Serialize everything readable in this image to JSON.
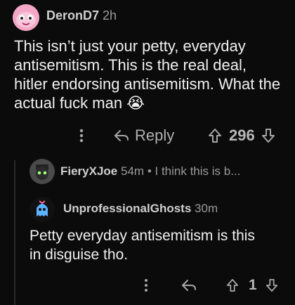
{
  "post": {
    "username": "DeronD7",
    "time": "2h",
    "body": "This isn’t just your petty, everyday antisemitism. This is the real deal, hitler endorsing antisemitism. What the actual fuck man",
    "emoji": "😭",
    "reply_label": "Reply",
    "score": "296"
  },
  "replies": [
    {
      "username": "FieryXJoe",
      "time": "54m",
      "separator": "•",
      "preview": "I think this is b..."
    },
    {
      "username": "UnprofessionalGhosts",
      "time": "30m",
      "body": "Petty everyday antisemitism is this in disguise tho.",
      "score": "1"
    }
  ],
  "icons": {
    "more": "more-icon",
    "reply": "reply-arrow-icon",
    "upvote": "upvote-icon",
    "downvote": "downvote-icon"
  },
  "colors": {
    "background": "#0b0b0b",
    "text": "#e9e9e9",
    "muted": "#9a9a9a",
    "avatar_pink": "#f4a6c6"
  }
}
